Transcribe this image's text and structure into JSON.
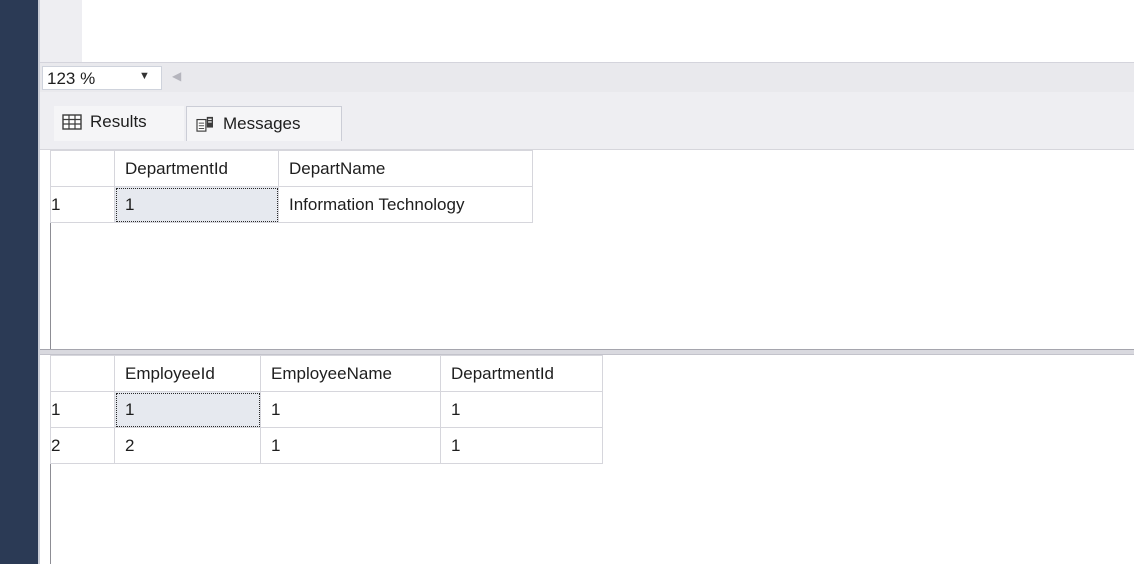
{
  "zoom": {
    "value": "123 %"
  },
  "tabs": [
    {
      "label": "Results",
      "icon": "grid-icon",
      "active": true
    },
    {
      "label": "Messages",
      "icon": "messages-icon",
      "active": false
    }
  ],
  "result_1": {
    "columns": [
      "DepartmentId",
      "DepartName"
    ],
    "rows": [
      {
        "num": "1",
        "cells": [
          "1",
          "Information Technology"
        ]
      }
    ]
  },
  "result_2": {
    "columns": [
      "EmployeeId",
      "EmployeeName",
      "DepartmentId"
    ],
    "rows": [
      {
        "num": "1",
        "cells": [
          "1",
          "1",
          "1"
        ]
      },
      {
        "num": "2",
        "cells": [
          "2",
          "1",
          "1"
        ]
      }
    ]
  },
  "colors": {
    "left_bar": "#2b3a55",
    "selected_cell": "#e6e9ef"
  }
}
